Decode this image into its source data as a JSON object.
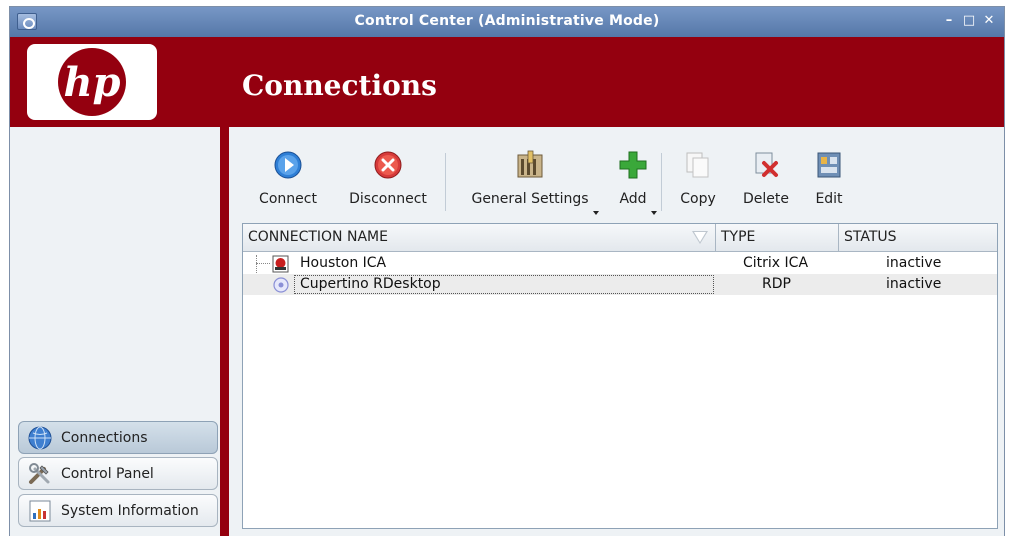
{
  "window": {
    "title": "Control Center (Administrative Mode)",
    "controls": {
      "minimize": "–",
      "maximize": "□",
      "close": "✕"
    }
  },
  "header": {
    "logo_text": "hp",
    "page_title": "Connections",
    "brand_color": "#94000f"
  },
  "sidebar": {
    "items": [
      {
        "label": "Connections",
        "icon": "globe-icon",
        "active": true
      },
      {
        "label": "Control Panel",
        "icon": "tools-icon",
        "active": false
      },
      {
        "label": "System Information",
        "icon": "bar-chart-icon",
        "active": false
      }
    ]
  },
  "toolbar": {
    "connect_label": "Connect",
    "disconnect_label": "Disconnect",
    "general_settings_label": "General Settings",
    "add_label": "Add",
    "copy_label": "Copy",
    "delete_label": "Delete",
    "edit_label": "Edit"
  },
  "table": {
    "columns": [
      "CONNECTION NAME",
      "TYPE",
      "STATUS"
    ],
    "rows": [
      {
        "name": "Houston ICA",
        "type": "Citrix ICA",
        "status": "inactive",
        "icon": "citrix-icon"
      },
      {
        "name": "Cupertino RDesktop",
        "type": "RDP",
        "status": "inactive",
        "icon": "rdp-icon"
      }
    ]
  }
}
